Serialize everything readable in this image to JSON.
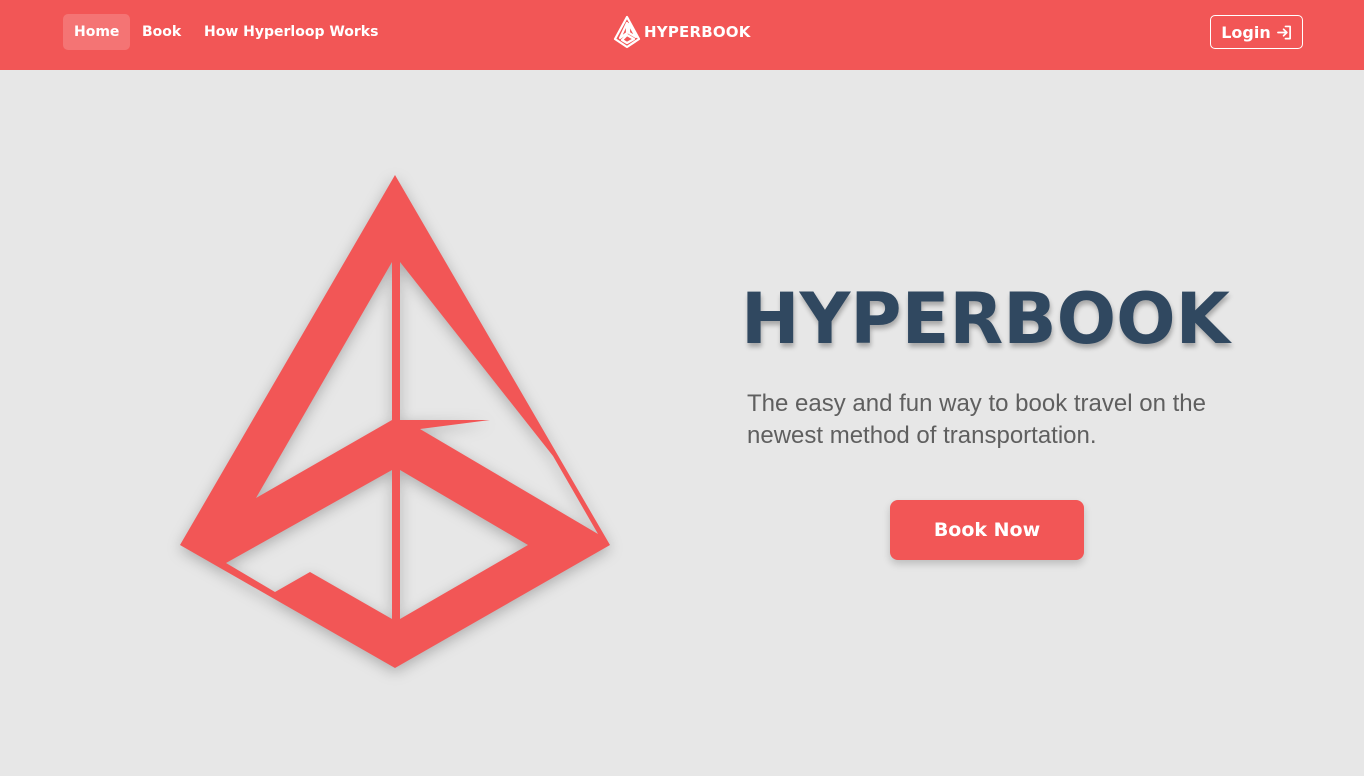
{
  "nav": {
    "items": [
      {
        "label": "Home",
        "active": true
      },
      {
        "label": "Book",
        "active": false
      },
      {
        "label": "How Hyperloop Works",
        "active": false
      }
    ]
  },
  "brand": {
    "name": "HYPERBOOK",
    "icon": "hyperbook-logo-icon"
  },
  "login": {
    "label": "Login",
    "icon": "login-arrow-icon"
  },
  "hero": {
    "title": "HYPERBOOK",
    "subtitle": "The easy and fun way to book travel on the newest method of transportation.",
    "cta_label": "Book Now",
    "logo_icon": "hyperbook-pyramid-logo"
  },
  "colors": {
    "accent": "#f25656",
    "title": "#304860",
    "text": "#5f5f5f",
    "background": "#e7e7e7"
  }
}
